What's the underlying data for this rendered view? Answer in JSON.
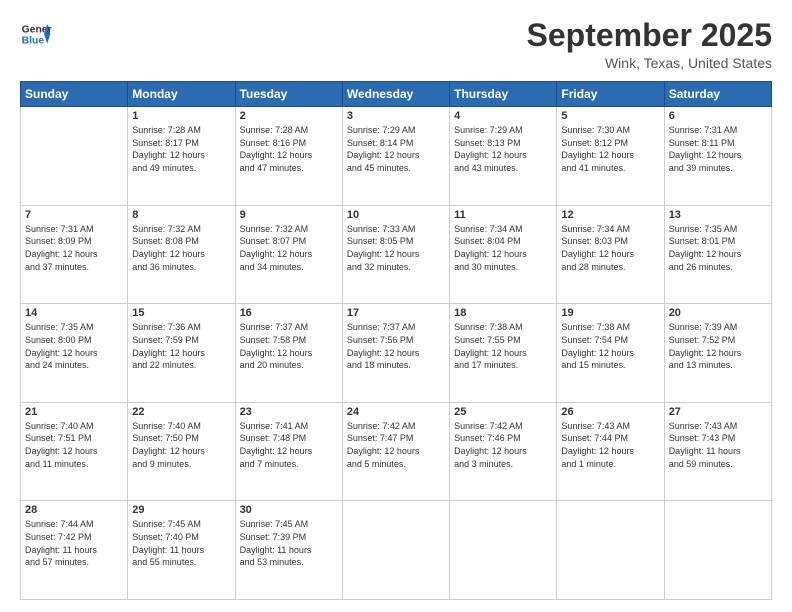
{
  "logo": {
    "general": "General",
    "blue": "Blue"
  },
  "header": {
    "month": "September 2025",
    "location": "Wink, Texas, United States"
  },
  "days_of_week": [
    "Sunday",
    "Monday",
    "Tuesday",
    "Wednesday",
    "Thursday",
    "Friday",
    "Saturday"
  ],
  "weeks": [
    [
      {
        "day": "",
        "info": ""
      },
      {
        "day": "1",
        "info": "Sunrise: 7:28 AM\nSunset: 8:17 PM\nDaylight: 12 hours\nand 49 minutes."
      },
      {
        "day": "2",
        "info": "Sunrise: 7:28 AM\nSunset: 8:16 PM\nDaylight: 12 hours\nand 47 minutes."
      },
      {
        "day": "3",
        "info": "Sunrise: 7:29 AM\nSunset: 8:14 PM\nDaylight: 12 hours\nand 45 minutes."
      },
      {
        "day": "4",
        "info": "Sunrise: 7:29 AM\nSunset: 8:13 PM\nDaylight: 12 hours\nand 43 minutes."
      },
      {
        "day": "5",
        "info": "Sunrise: 7:30 AM\nSunset: 8:12 PM\nDaylight: 12 hours\nand 41 minutes."
      },
      {
        "day": "6",
        "info": "Sunrise: 7:31 AM\nSunset: 8:11 PM\nDaylight: 12 hours\nand 39 minutes."
      }
    ],
    [
      {
        "day": "7",
        "info": "Sunrise: 7:31 AM\nSunset: 8:09 PM\nDaylight: 12 hours\nand 37 minutes."
      },
      {
        "day": "8",
        "info": "Sunrise: 7:32 AM\nSunset: 8:08 PM\nDaylight: 12 hours\nand 36 minutes."
      },
      {
        "day": "9",
        "info": "Sunrise: 7:32 AM\nSunset: 8:07 PM\nDaylight: 12 hours\nand 34 minutes."
      },
      {
        "day": "10",
        "info": "Sunrise: 7:33 AM\nSunset: 8:05 PM\nDaylight: 12 hours\nand 32 minutes."
      },
      {
        "day": "11",
        "info": "Sunrise: 7:34 AM\nSunset: 8:04 PM\nDaylight: 12 hours\nand 30 minutes."
      },
      {
        "day": "12",
        "info": "Sunrise: 7:34 AM\nSunset: 8:03 PM\nDaylight: 12 hours\nand 28 minutes."
      },
      {
        "day": "13",
        "info": "Sunrise: 7:35 AM\nSunset: 8:01 PM\nDaylight: 12 hours\nand 26 minutes."
      }
    ],
    [
      {
        "day": "14",
        "info": "Sunrise: 7:35 AM\nSunset: 8:00 PM\nDaylight: 12 hours\nand 24 minutes."
      },
      {
        "day": "15",
        "info": "Sunrise: 7:36 AM\nSunset: 7:59 PM\nDaylight: 12 hours\nand 22 minutes."
      },
      {
        "day": "16",
        "info": "Sunrise: 7:37 AM\nSunset: 7:58 PM\nDaylight: 12 hours\nand 20 minutes."
      },
      {
        "day": "17",
        "info": "Sunrise: 7:37 AM\nSunset: 7:56 PM\nDaylight: 12 hours\nand 18 minutes."
      },
      {
        "day": "18",
        "info": "Sunrise: 7:38 AM\nSunset: 7:55 PM\nDaylight: 12 hours\nand 17 minutes."
      },
      {
        "day": "19",
        "info": "Sunrise: 7:38 AM\nSunset: 7:54 PM\nDaylight: 12 hours\nand 15 minutes."
      },
      {
        "day": "20",
        "info": "Sunrise: 7:39 AM\nSunset: 7:52 PM\nDaylight: 12 hours\nand 13 minutes."
      }
    ],
    [
      {
        "day": "21",
        "info": "Sunrise: 7:40 AM\nSunset: 7:51 PM\nDaylight: 12 hours\nand 11 minutes."
      },
      {
        "day": "22",
        "info": "Sunrise: 7:40 AM\nSunset: 7:50 PM\nDaylight: 12 hours\nand 9 minutes."
      },
      {
        "day": "23",
        "info": "Sunrise: 7:41 AM\nSunset: 7:48 PM\nDaylight: 12 hours\nand 7 minutes."
      },
      {
        "day": "24",
        "info": "Sunrise: 7:42 AM\nSunset: 7:47 PM\nDaylight: 12 hours\nand 5 minutes."
      },
      {
        "day": "25",
        "info": "Sunrise: 7:42 AM\nSunset: 7:46 PM\nDaylight: 12 hours\nand 3 minutes."
      },
      {
        "day": "26",
        "info": "Sunrise: 7:43 AM\nSunset: 7:44 PM\nDaylight: 12 hours\nand 1 minute."
      },
      {
        "day": "27",
        "info": "Sunrise: 7:43 AM\nSunset: 7:43 PM\nDaylight: 11 hours\nand 59 minutes."
      }
    ],
    [
      {
        "day": "28",
        "info": "Sunrise: 7:44 AM\nSunset: 7:42 PM\nDaylight: 11 hours\nand 57 minutes."
      },
      {
        "day": "29",
        "info": "Sunrise: 7:45 AM\nSunset: 7:40 PM\nDaylight: 11 hours\nand 55 minutes."
      },
      {
        "day": "30",
        "info": "Sunrise: 7:45 AM\nSunset: 7:39 PM\nDaylight: 11 hours\nand 53 minutes."
      },
      {
        "day": "",
        "info": ""
      },
      {
        "day": "",
        "info": ""
      },
      {
        "day": "",
        "info": ""
      },
      {
        "day": "",
        "info": ""
      }
    ]
  ]
}
